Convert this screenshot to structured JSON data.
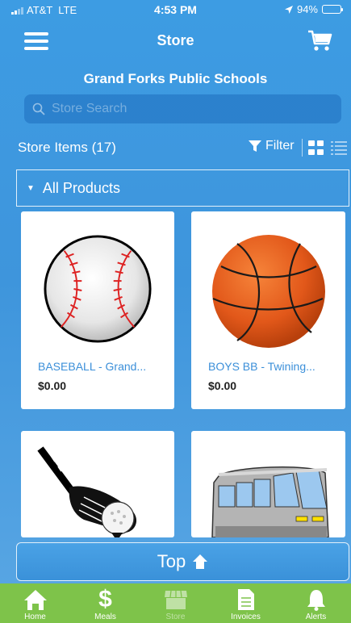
{
  "status_bar": {
    "carrier": "AT&T",
    "network": "LTE",
    "time": "4:53 PM",
    "battery": "94%",
    "battery_level": 0.94
  },
  "nav": {
    "title": "Store"
  },
  "school_name": "Grand Forks Public Schools",
  "search": {
    "placeholder": "Store Search",
    "value": ""
  },
  "store_items": {
    "label": "Store Items (17)",
    "filter_label": "Filter"
  },
  "category": {
    "label": "All Products"
  },
  "products": [
    {
      "name": "BASEBALL - Grand...",
      "price": "$0.00",
      "icon": "baseball-image"
    },
    {
      "name": "BOYS BB - Twining...",
      "price": "$0.00",
      "icon": "basketball-image"
    },
    {
      "name": "",
      "price": "",
      "icon": "golf-club-image"
    },
    {
      "name": "",
      "price": "",
      "icon": "bus-image"
    }
  ],
  "top_button": {
    "label": "Top"
  },
  "tabs": [
    {
      "label": "Home",
      "icon": "home-icon",
      "active": true
    },
    {
      "label": "Meals",
      "icon": "dollar-icon",
      "active": true
    },
    {
      "label": "Store",
      "icon": "store-icon",
      "active": false
    },
    {
      "label": "Invoices",
      "icon": "invoice-icon",
      "active": true
    },
    {
      "label": "Alerts",
      "icon": "bell-icon",
      "active": true
    }
  ],
  "colors": {
    "background": "#3e95dc",
    "tabbar": "#7ec34a",
    "product_name": "#3b8fd9"
  }
}
